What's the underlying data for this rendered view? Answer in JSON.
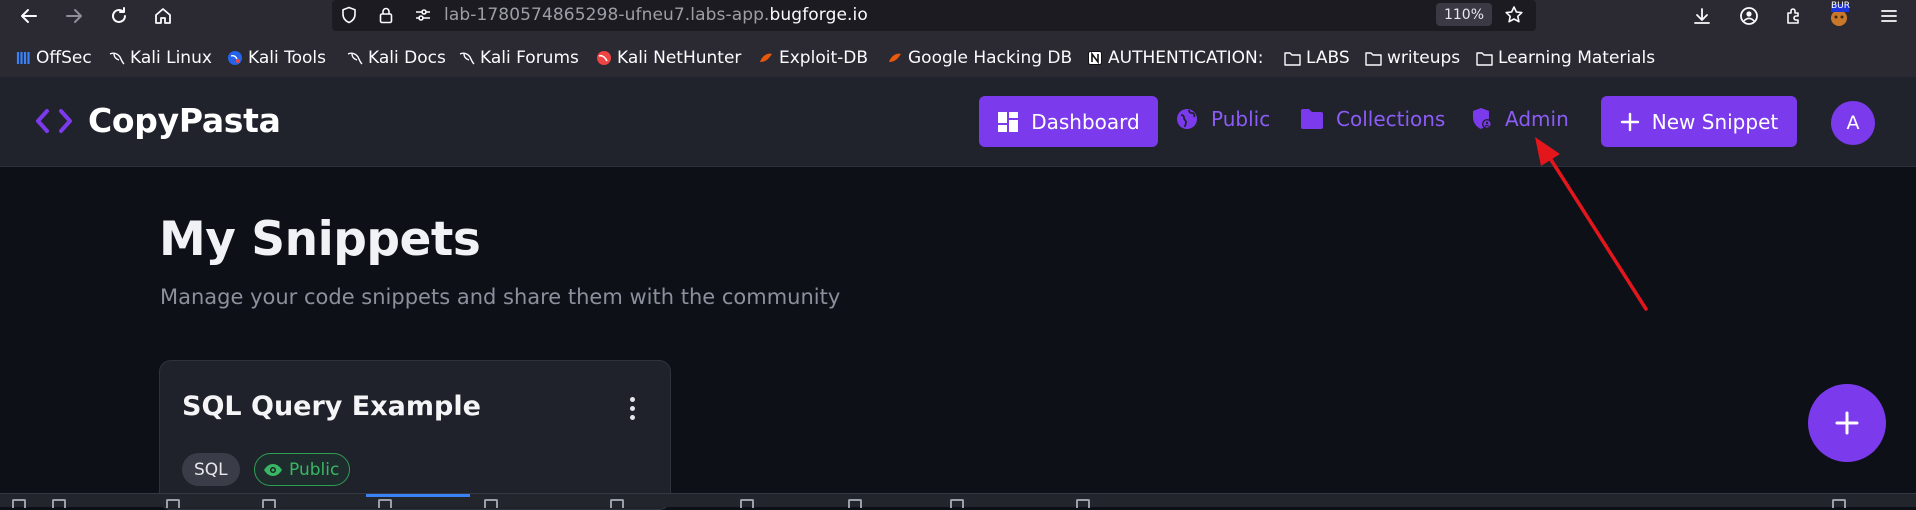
{
  "browser": {
    "url_prefix": "lab-1780574865298-ufneu7.labs-app.",
    "url_domain": "bugforge.io",
    "zoom": "110%",
    "icons": [
      "back-arrow-icon",
      "forward-arrow-icon",
      "reload-icon",
      "home-icon",
      "shield-icon",
      "lock-icon",
      "site-settings-icon",
      "star-icon",
      "download-icon",
      "account-icon",
      "extensions-icon",
      "extension-badge-icon",
      "menu-icon"
    ],
    "extension_badge": "BUR"
  },
  "bookmarks": [
    {
      "label": "OffSec",
      "icon": "offsec-icon"
    },
    {
      "label": "Kali Linux",
      "icon": "kali-dragon-icon"
    },
    {
      "label": "Kali Tools",
      "icon": "kali-tools-icon"
    },
    {
      "label": "Kali Docs",
      "icon": "kali-dragon-icon"
    },
    {
      "label": "Kali Forums",
      "icon": "kali-dragon-icon"
    },
    {
      "label": "Kali NetHunter",
      "icon": "nethunter-icon"
    },
    {
      "label": "Exploit-DB",
      "icon": "exploitdb-icon"
    },
    {
      "label": "Google Hacking DB",
      "icon": "ghdb-icon"
    },
    {
      "label": "AUTHENTICATION:",
      "icon": "notion-icon"
    },
    {
      "label": "LABS",
      "icon": "folder-icon"
    },
    {
      "label": "writeups",
      "icon": "folder-icon"
    },
    {
      "label": "Learning Materials",
      "icon": "folder-icon"
    }
  ],
  "app": {
    "name": "CopyPasta",
    "logo_icon": "code-brackets-icon",
    "nav": {
      "dashboard": "Dashboard",
      "public": "Public",
      "collections": "Collections",
      "admin": "Admin",
      "new_snippet": "New Snippet"
    },
    "avatar_letter": "A",
    "accent": "#7c3aed"
  },
  "main": {
    "title": "My Snippets",
    "subtitle": "Manage your code snippets and share them with the community",
    "snippets": [
      {
        "title": "SQL Query Example",
        "language": "SQL",
        "visibility": "Public"
      }
    ]
  },
  "annotation": {
    "color": "#e3161c"
  }
}
